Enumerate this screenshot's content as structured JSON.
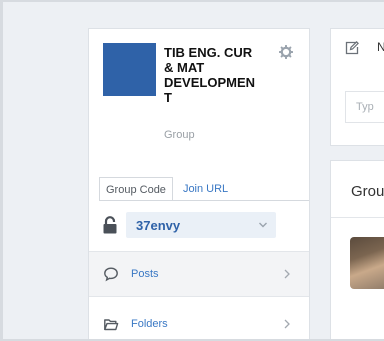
{
  "group": {
    "title": "TIB ENG. CUR\n& MAT\nDEVELOPMEN\nT",
    "type_label": "Group",
    "avatar_color": "#2f62a8",
    "settings_icon": "gear-icon"
  },
  "tabs": [
    {
      "label": "Group Code",
      "active": true
    },
    {
      "label": "Join URL",
      "active": false
    }
  ],
  "group_code": {
    "value": "37envy",
    "lock_icon": "lock-icon",
    "dropdown_icon": "chevron-down-icon"
  },
  "nav": {
    "posts": {
      "label": "Posts",
      "icon": "speech-bubble-icon"
    },
    "folders": {
      "label": "Folders",
      "icon": "folder-icon"
    }
  },
  "compose": {
    "icon": "edit-icon",
    "label_partial": "N",
    "placeholder_partial": "Typ"
  },
  "feed": {
    "title_partial": "Grou"
  },
  "colors": {
    "accent": "#2f62a8",
    "link": "#3a78c4",
    "background": "#edf0f4"
  }
}
